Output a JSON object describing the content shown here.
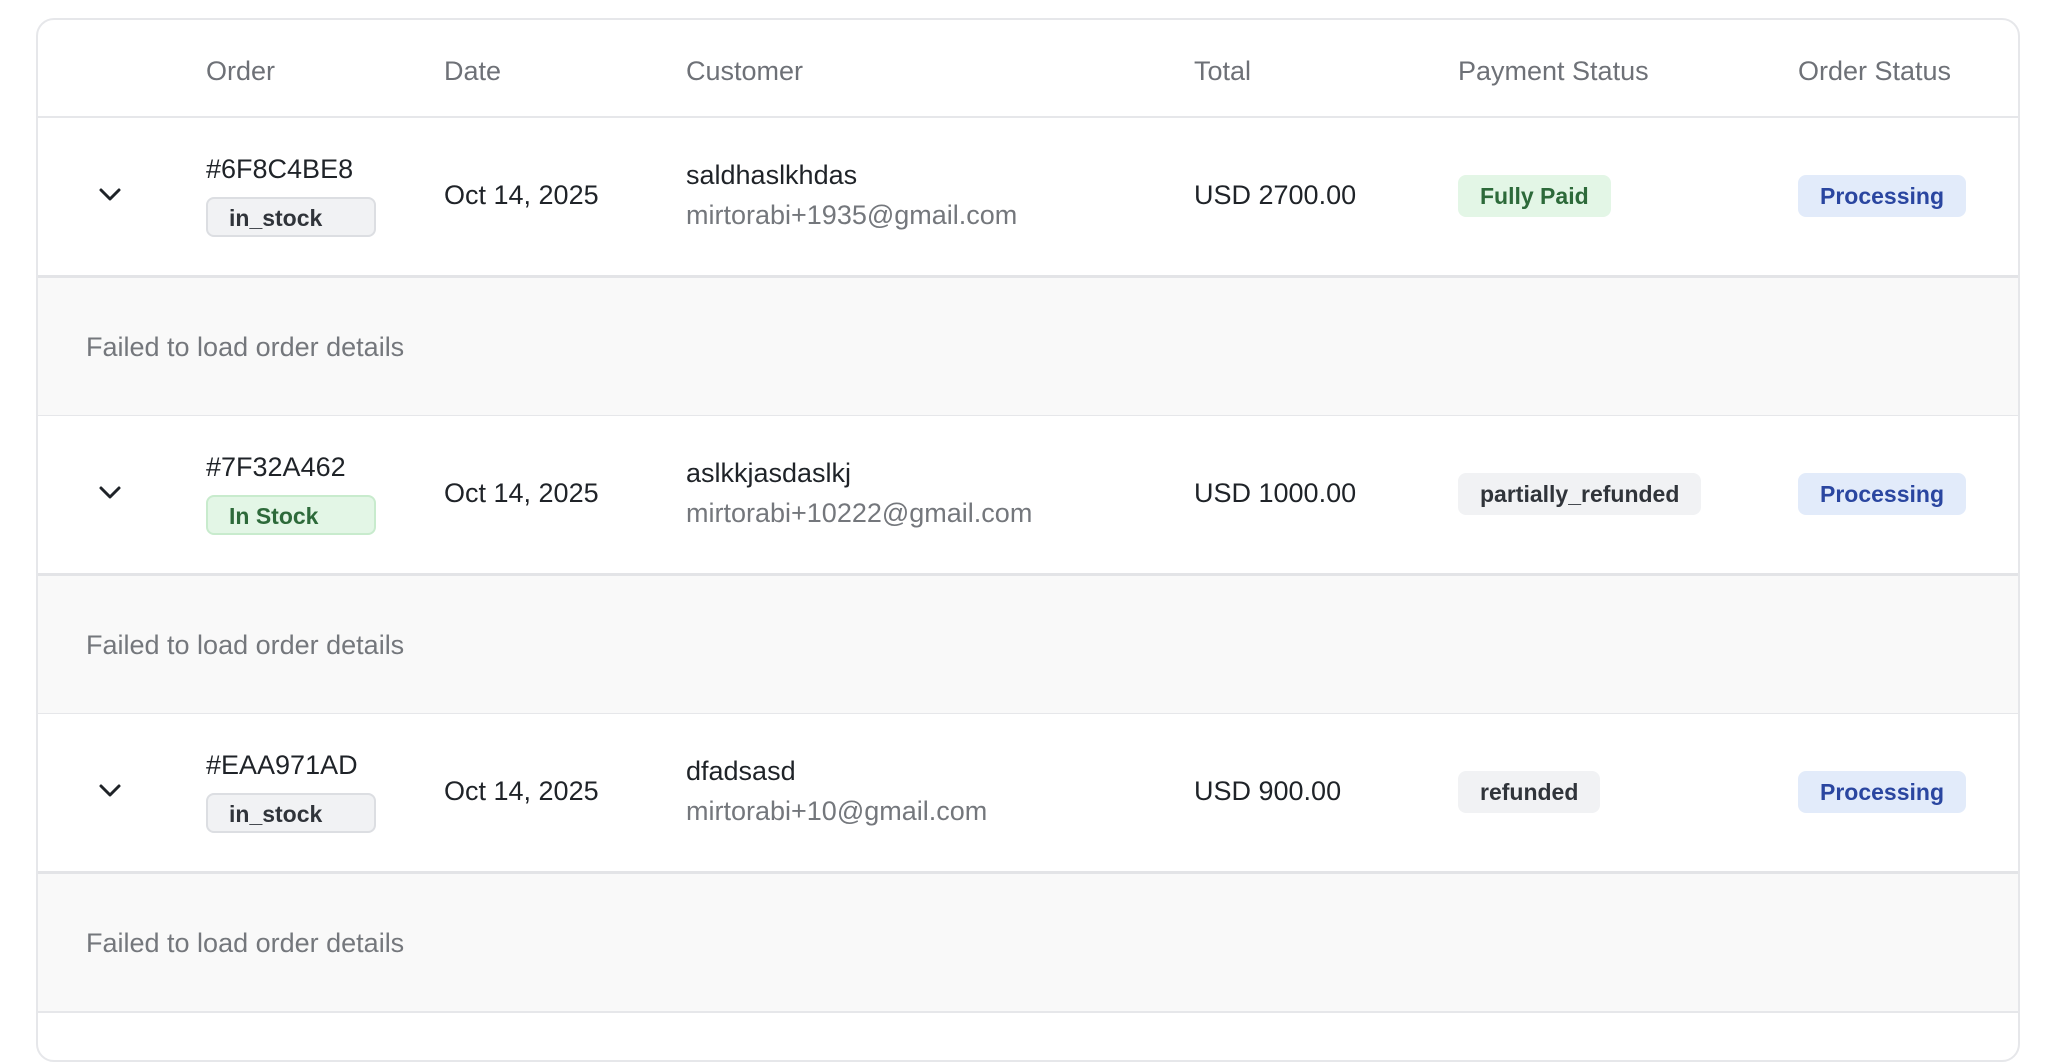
{
  "table": {
    "columns": {
      "order": "Order",
      "date": "Date",
      "customer": "Customer",
      "total": "Total",
      "payment_status": "Payment Status",
      "order_status": "Order Status"
    },
    "rows": [
      {
        "id": "#6F8C4BE8",
        "stock": "in_stock",
        "stock_style": "neutral",
        "date": "Oct 14, 2025",
        "customer_name": "saldhaslkhdas",
        "customer_email": "mirtorabi+1935@gmail.com",
        "total": "USD 2700.00",
        "payment_status": "Fully Paid",
        "payment_style": "green",
        "order_status": "Processing",
        "detail_message": "Failed to load order details"
      },
      {
        "id": "#7F32A462",
        "stock": "In Stock",
        "stock_style": "green",
        "date": "Oct 14, 2025",
        "customer_name": "aslkkjasdaslkj",
        "customer_email": "mirtorabi+10222@gmail.com",
        "total": "USD 1000.00",
        "payment_status": "partially_refunded",
        "payment_style": "gray",
        "order_status": "Processing",
        "detail_message": "Failed to load order details"
      },
      {
        "id": "#EAA971AD",
        "stock": "in_stock",
        "stock_style": "neutral",
        "date": "Oct 14, 2025",
        "customer_name": "dfadsasd",
        "customer_email": "mirtorabi+10@gmail.com",
        "total": "USD 900.00",
        "payment_status": "refunded",
        "payment_style": "gray",
        "order_status": "Processing",
        "detail_message": "Failed to load order details"
      }
    ]
  },
  "icons": {
    "expand": "chevron-down-icon"
  },
  "colors": {
    "paid_bg": "#e3f6e6",
    "paid_text": "#2d6a3a",
    "neutral_bg": "#f1f2f4",
    "processing_bg": "#e2ebfa",
    "processing_text": "#2a46a0",
    "detail_bg": "#f9f9f9"
  }
}
